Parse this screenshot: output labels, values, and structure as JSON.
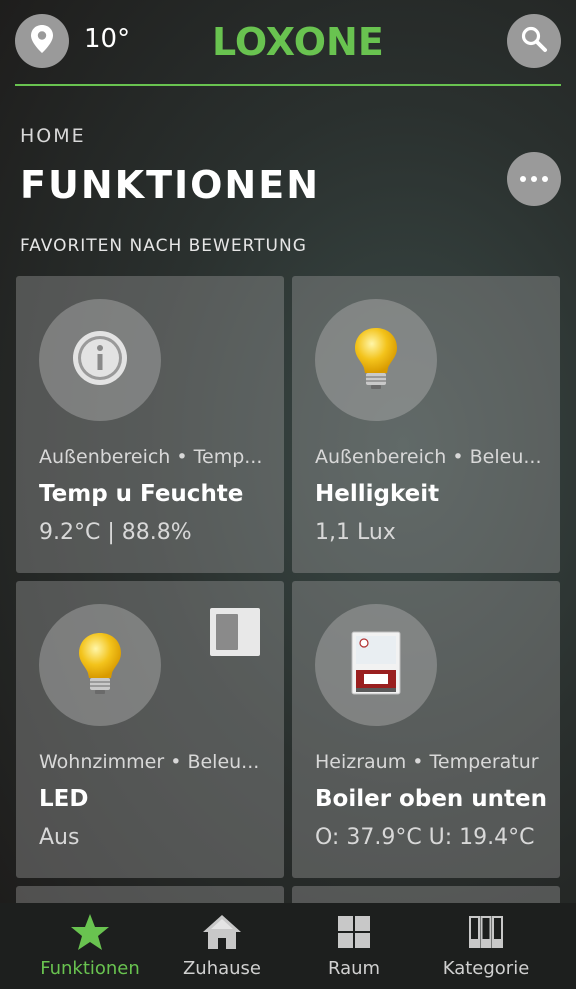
{
  "header": {
    "temperature": "10°",
    "logo": "LOXONE",
    "location_icon": "location-pin-icon",
    "search_icon": "search-icon"
  },
  "breadcrumb": "HOME",
  "page_title": "FUNKTIONEN",
  "section_title": "FAVORITEN NACH BEWERTUNG",
  "cards": [
    {
      "subtitle": "Außenbereich • Temp...",
      "title": "Temp u Feuchte",
      "value": "9.2°C | 88.8%",
      "icon": "info-icon"
    },
    {
      "subtitle": "Außenbereich • Beleu...",
      "title": "Helligkeit",
      "value": "1,1 Lux",
      "icon": "light-bulb-icon"
    },
    {
      "subtitle": "Wohnzimmer • Beleu...",
      "title": "LED",
      "value": "Aus",
      "icon": "light-bulb-icon"
    },
    {
      "subtitle": "Heizraum • Temperatur",
      "title": "Boiler oben unten",
      "value": "O: 37.9°C U: 19.4°C",
      "icon": "boiler-icon"
    }
  ],
  "nav": [
    {
      "label": "Funktionen",
      "icon": "star-icon",
      "active": true
    },
    {
      "label": "Zuhause",
      "icon": "house-icon",
      "active": false
    },
    {
      "label": "Raum",
      "icon": "grid-icon",
      "active": false
    },
    {
      "label": "Kategorie",
      "icon": "columns-icon",
      "active": false
    }
  ],
  "colors": {
    "accent": "#69c350",
    "button": "#9a9a9a"
  }
}
